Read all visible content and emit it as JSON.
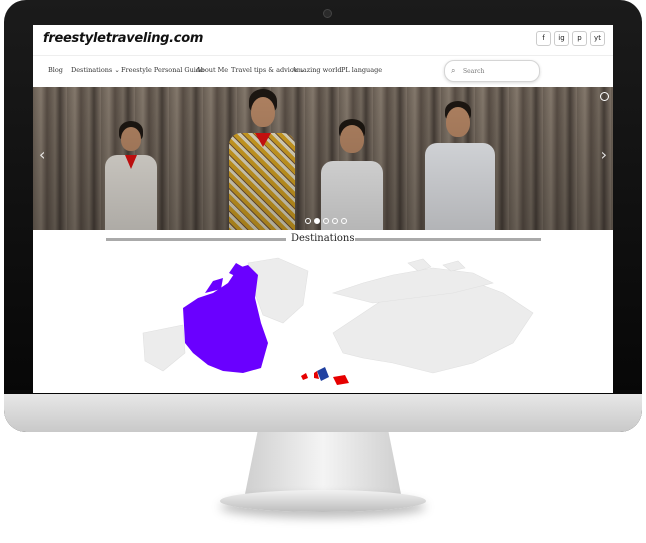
{
  "site": {
    "logo": "freestyletraveling.com"
  },
  "social": [
    "f",
    "ig",
    "p",
    "yt"
  ],
  "nav": {
    "items": [
      {
        "label": "Blog"
      },
      {
        "label": "Destinations ⌄"
      },
      {
        "label": "Freestyle Personal Guide"
      },
      {
        "label": "About Me"
      },
      {
        "label": "Travel tips & advice ⌄"
      },
      {
        "label": "Amazing world"
      },
      {
        "label": "PL language"
      }
    ],
    "search_placeholder": "Search"
  },
  "hero": {
    "slide_count": 5,
    "active_slide": 1
  },
  "destinations": {
    "title": "Destinations"
  },
  "colors": {
    "visited": "#6a00ff",
    "wishlist": "#e60000",
    "uk": "#2040a0",
    "land": "#ececec",
    "bezel": "#0a0a0a"
  }
}
